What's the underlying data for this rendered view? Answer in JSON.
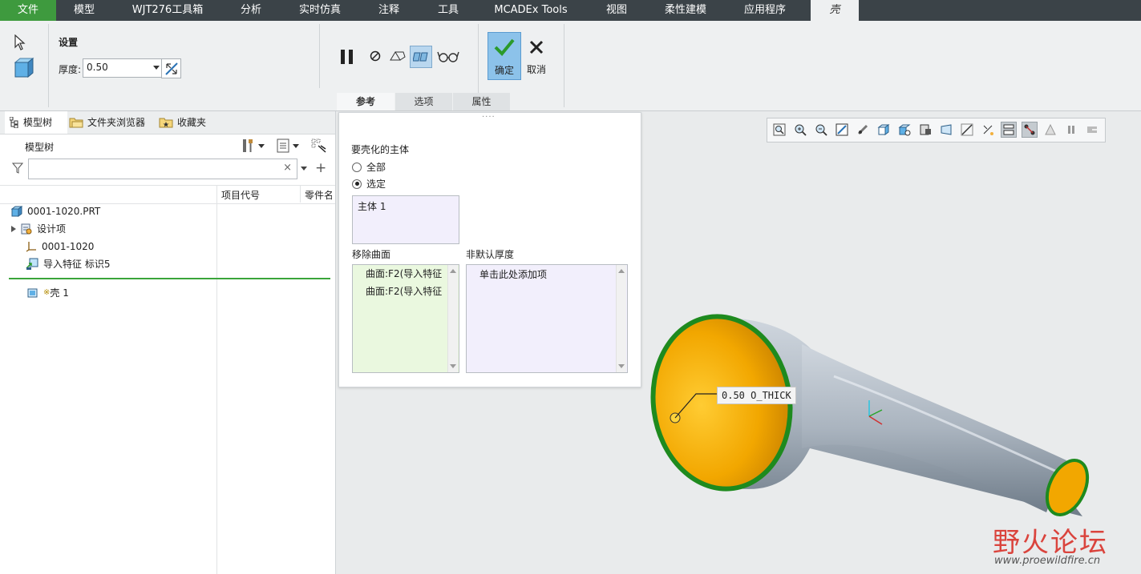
{
  "menu": {
    "items": [
      "文件",
      "模型",
      "WJT276工具箱",
      "分析",
      "实时仿真",
      "注释",
      "工具",
      "MCADEx Tools",
      "视图",
      "柔性建模",
      "应用程序",
      "壳"
    ],
    "active": "壳"
  },
  "ribbon": {
    "settings_title": "设置",
    "thickness_label": "厚度:",
    "thickness_value": "0.50",
    "confirm_label": "确定",
    "cancel_label": "取消",
    "dashboard_tabs": [
      "参考",
      "选项",
      "属性"
    ],
    "selected_tab": "参考"
  },
  "left_panel": {
    "tabs": [
      "模型树",
      "文件夹浏览器",
      "收藏夹"
    ],
    "title": "模型树",
    "search_placeholder": "",
    "columns": [
      "项目代号",
      "零件名"
    ],
    "tree": [
      {
        "label": "0001-1020.PRT",
        "icon": "part-icon"
      },
      {
        "label": "设计项",
        "icon": "design-items-icon"
      },
      {
        "label": "0001-1020",
        "icon": "csys-icon"
      },
      {
        "label": "导入特征 标识5",
        "icon": "import-feature-icon"
      },
      {
        "label": "壳 1",
        "icon": "shell-feature-icon",
        "prefix": "※"
      }
    ]
  },
  "ref_panel": {
    "bodies_label": "要壳化的主体",
    "radio_all": "全部",
    "radio_selected": "选定",
    "selected_radio": "选定",
    "body_item": "主体 1",
    "remove_surfaces_label": "移除曲面",
    "remove_surfaces": [
      "曲面:F2(导入特征",
      "曲面:F2(导入特征"
    ],
    "nondefault_label": "非默认厚度",
    "nondefault_hint": "单击此处添加项"
  },
  "viewport": {
    "dimension_label": "0.50 O_THICK",
    "watermark_cn": "野火论坛",
    "watermark_url": "www.proewildfire.cn",
    "toolbar_icons": [
      "refit-icon",
      "zoom-in-icon",
      "zoom-out-icon",
      "repaint-icon",
      "spin-center-icon",
      "saved-orientations-icon",
      "view-manager-icon",
      "display-style-icon",
      "perspective-icon",
      "datum-display-icon",
      "annotation-display-icon",
      "model-tree-icon",
      "connector-icon",
      "simulation-icon",
      "pause-icon",
      "exit-icon"
    ]
  },
  "colors": {
    "menubar": "#3b4348",
    "file_tab": "#3e9a3e",
    "confirm": "#8cc2ea",
    "pipe": "#a8b2bd",
    "inner": "#f2a700",
    "rim": "#1e8a1e"
  }
}
